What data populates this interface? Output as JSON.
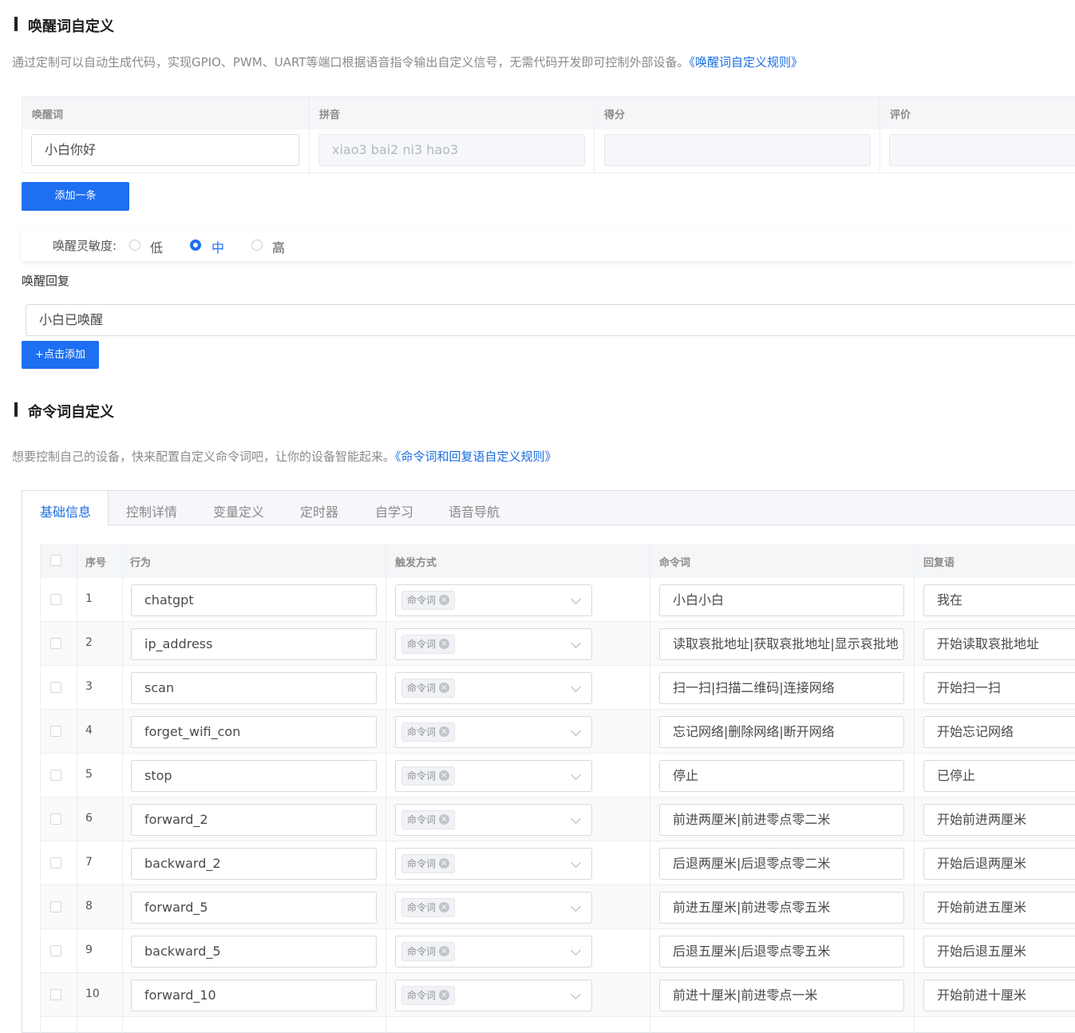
{
  "wake": {
    "title": "唤醒词自定义",
    "description": "通过定制可以自动生成代码，实现GPIO、PWM、UART等端口根据语音指令输出自定义信号，无需代码开发即可控制外部设备。",
    "rules_link": "《唤醒词自定义规则》",
    "table_headers": [
      "唤醒词",
      "拼音",
      "得分",
      "评价"
    ],
    "word_value": "小白你好",
    "pinyin_value": "xiao3 bai2 ni3 hao3",
    "score_value": "",
    "rating_value": "",
    "add_button": "添加一条",
    "sensitivity_label": "唤醒灵敏度:",
    "sensitivity_options": [
      "低",
      "中",
      "高"
    ],
    "sensitivity_selected": "中",
    "reply_label": "唤醒回复",
    "reply_value": "小白已唤醒",
    "add_reply_button": "+点击添加"
  },
  "command": {
    "title": "命令词自定义",
    "description": "想要控制自己的设备，快来配置自定义命令词吧，让你的设备智能起来。",
    "rules_link": "《命令词和回复语自定义规则》",
    "tabs": [
      "基础信息",
      "控制详情",
      "变量定义",
      "定时器",
      "自学习",
      "语音导航"
    ],
    "active_tab": "基础信息",
    "headers": {
      "seq": "序号",
      "action": "行为",
      "trigger": "触发方式",
      "command": "命令词",
      "reply": "回复语"
    },
    "rows": [
      {
        "seq": "1",
        "action": "chatgpt",
        "trigger": "命令词",
        "command": "小白小白",
        "reply": "我在"
      },
      {
        "seq": "2",
        "action": "ip_address",
        "trigger": "命令词",
        "command": "读取哀批地址|获取哀批地址|显示哀批地",
        "reply": "开始读取哀批地址"
      },
      {
        "seq": "3",
        "action": "scan",
        "trigger": "命令词",
        "command": "扫一扫|扫描二维码|连接网络",
        "reply": "开始扫一扫"
      },
      {
        "seq": "4",
        "action": "forget_wifi_con",
        "trigger": "命令词",
        "command": "忘记网络|删除网络|断开网络",
        "reply": "开始忘记网络"
      },
      {
        "seq": "5",
        "action": "stop",
        "trigger": "命令词",
        "command": "停止",
        "reply": "已停止"
      },
      {
        "seq": "6",
        "action": "forward_2",
        "trigger": "命令词",
        "command": "前进两厘米|前进零点零二米",
        "reply": "开始前进两厘米"
      },
      {
        "seq": "7",
        "action": "backward_2",
        "trigger": "命令词",
        "command": "后退两厘米|后退零点零二米",
        "reply": "开始后退两厘米"
      },
      {
        "seq": "8",
        "action": "forward_5",
        "trigger": "命令词",
        "command": "前进五厘米|前进零点零五米",
        "reply": "开始前进五厘米"
      },
      {
        "seq": "9",
        "action": "backward_5",
        "trigger": "命令词",
        "command": "后退五厘米|后退零点零五米",
        "reply": "开始后退五厘米"
      },
      {
        "seq": "10",
        "action": "forward_10",
        "trigger": "命令词",
        "command": "前进十厘米|前进零点一米",
        "reply": "开始前进十厘米"
      }
    ]
  },
  "colors": {
    "accent": "#1e6ff1",
    "link": "#1a6ee0"
  }
}
